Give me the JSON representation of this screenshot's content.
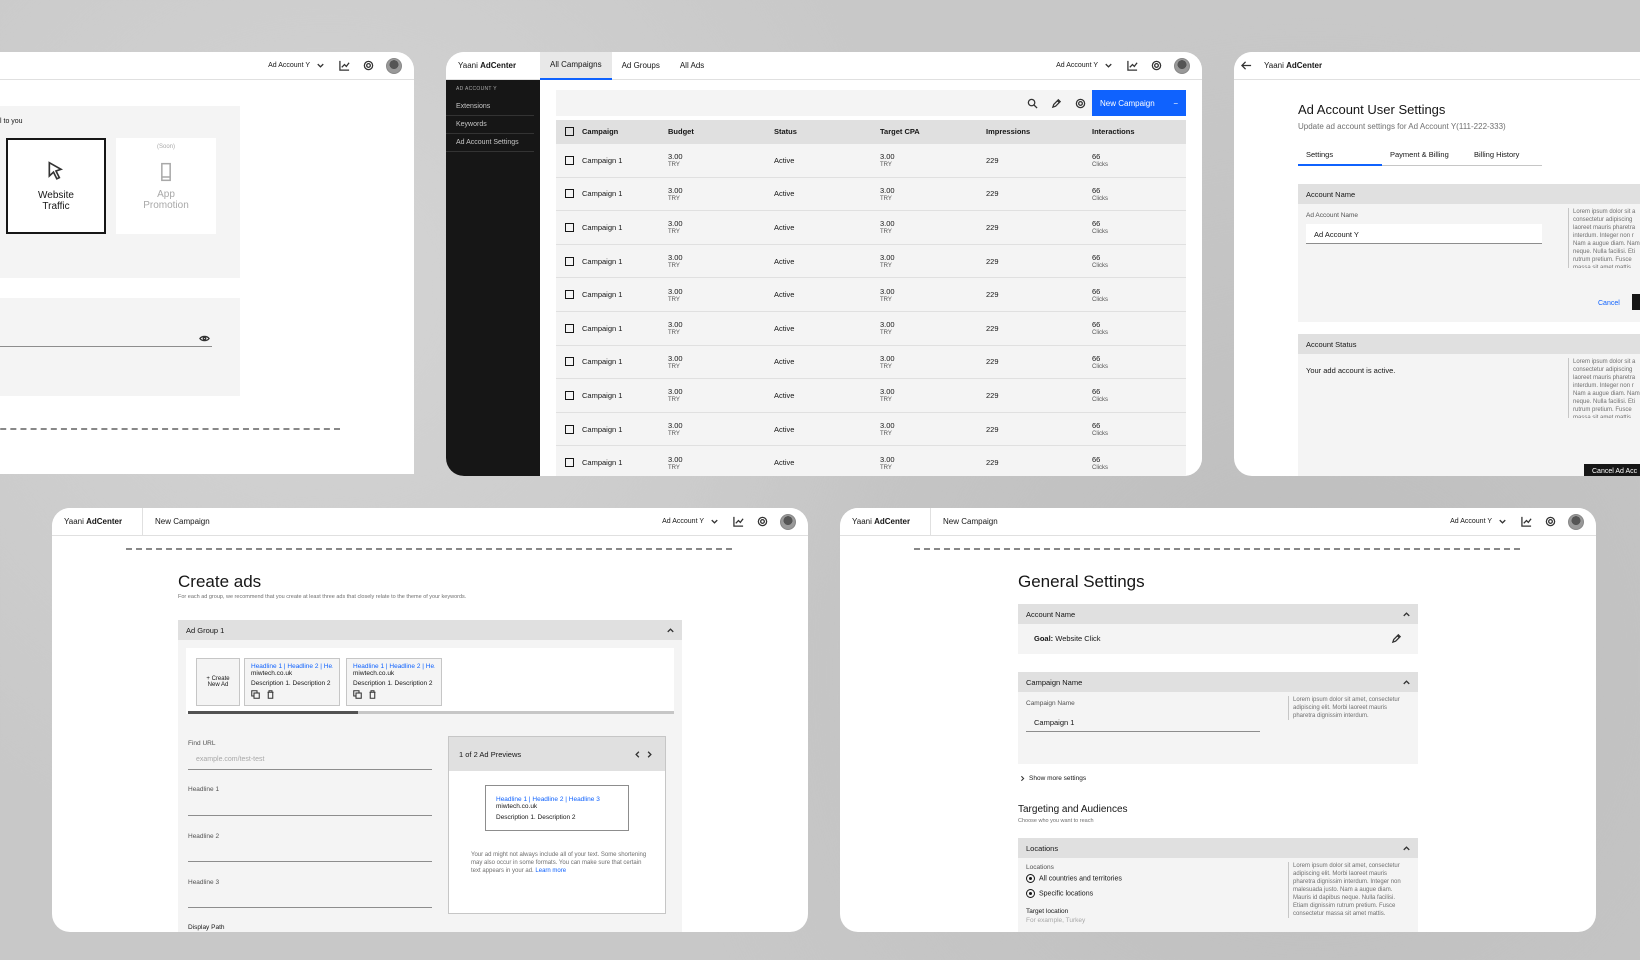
{
  "common": {
    "brand_prefix": "Yaani",
    "brand_name": "AdCenter",
    "account_selector": "Ad Account Y",
    "new_campaign_label": "New Campaign"
  },
  "panel_a": {
    "intro_text": "l to you",
    "tile_website": "Website Traffic",
    "tile_app_soon": "(Soon)",
    "tile_app": "App Promotion"
  },
  "panel_b": {
    "tabs": [
      "All Campaigns",
      "Ad Groups",
      "All Ads"
    ],
    "sidebar_header": "AD ACCOUNT Y",
    "sidebar_items": [
      "Extensions",
      "Keywords",
      "Ad Account Settings"
    ],
    "new_campaign_button": "New Campaign",
    "columns": [
      "Campaign",
      "Budget",
      "Status",
      "Target CPA",
      "Impressions",
      "Interactions"
    ],
    "rows": [
      {
        "campaign": "Campaign 1",
        "budget": "3.00",
        "budget_unit": "TRY",
        "status": "Active",
        "cpa": "3.00",
        "cpa_unit": "TRY",
        "impressions": "229",
        "interactions": "66",
        "interactions_unit": "Clicks"
      },
      {
        "campaign": "Campaign 1",
        "budget": "3.00",
        "budget_unit": "TRY",
        "status": "Active",
        "cpa": "3.00",
        "cpa_unit": "TRY",
        "impressions": "229",
        "interactions": "66",
        "interactions_unit": "Clicks"
      },
      {
        "campaign": "Campaign 1",
        "budget": "3.00",
        "budget_unit": "TRY",
        "status": "Active",
        "cpa": "3.00",
        "cpa_unit": "TRY",
        "impressions": "229",
        "interactions": "66",
        "interactions_unit": "Clicks"
      },
      {
        "campaign": "Campaign 1",
        "budget": "3.00",
        "budget_unit": "TRY",
        "status": "Active",
        "cpa": "3.00",
        "cpa_unit": "TRY",
        "impressions": "229",
        "interactions": "66",
        "interactions_unit": "Clicks"
      },
      {
        "campaign": "Campaign 1",
        "budget": "3.00",
        "budget_unit": "TRY",
        "status": "Active",
        "cpa": "3.00",
        "cpa_unit": "TRY",
        "impressions": "229",
        "interactions": "66",
        "interactions_unit": "Clicks"
      },
      {
        "campaign": "Campaign 1",
        "budget": "3.00",
        "budget_unit": "TRY",
        "status": "Active",
        "cpa": "3.00",
        "cpa_unit": "TRY",
        "impressions": "229",
        "interactions": "66",
        "interactions_unit": "Clicks"
      },
      {
        "campaign": "Campaign 1",
        "budget": "3.00",
        "budget_unit": "TRY",
        "status": "Active",
        "cpa": "3.00",
        "cpa_unit": "TRY",
        "impressions": "229",
        "interactions": "66",
        "interactions_unit": "Clicks"
      },
      {
        "campaign": "Campaign 1",
        "budget": "3.00",
        "budget_unit": "TRY",
        "status": "Active",
        "cpa": "3.00",
        "cpa_unit": "TRY",
        "impressions": "229",
        "interactions": "66",
        "interactions_unit": "Clicks"
      },
      {
        "campaign": "Campaign 1",
        "budget": "3.00",
        "budget_unit": "TRY",
        "status": "Active",
        "cpa": "3.00",
        "cpa_unit": "TRY",
        "impressions": "229",
        "interactions": "66",
        "interactions_unit": "Clicks"
      },
      {
        "campaign": "Campaign 1",
        "budget": "3.00",
        "budget_unit": "TRY",
        "status": "Active",
        "cpa": "3.00",
        "cpa_unit": "TRY",
        "impressions": "229",
        "interactions": "66",
        "interactions_unit": "Clicks"
      }
    ]
  },
  "panel_c": {
    "title": "Ad Account User Settings",
    "subtitle": "Update ad account settings for Ad Account Y(111-222-333)",
    "tabs": [
      "Settings",
      "Payment & Billing",
      "Billing History"
    ],
    "section_account_name": "Account Name",
    "field_label": "Ad Account Name",
    "field_value": "Ad Account Y",
    "cancel_link": "Cancel",
    "section_status": "Account Status",
    "status_text": "Your add account is active.",
    "cancel_account_button": "Cancel Ad Acc",
    "lorem": "Lorem ipsum dolor sit a consectetur adipiscing laoreet mauris pharetra interdum. Integer non r Nam a augue diam. Nam neque. Nulla facilisi. Eti rutrum pretium. Fusce massa sit amet mattis."
  },
  "panel_d": {
    "title": "Create ads",
    "subtitle": "For each ad group, we recommend that you create at least three ads that closely relate to the theme of your keywords.",
    "ad_group": "Ad Group 1",
    "create_new_ad": "+ Create New Ad",
    "ad_headline_short": "Headline 1 | Headline 2 | He...",
    "ad_url": "miwtech.co.uk",
    "ad_desc": "Description 1. Description 2",
    "final_url_label": "Find URL",
    "final_url_placeholder": "example.com/test-test",
    "headline1_label": "Headline 1",
    "headline2_label": "Headline 2",
    "headline3_label": "Headline 3",
    "display_path_label": "Display Path",
    "preview_header": "1 of 2 Ad Previews",
    "preview_headline": "Headline 1 | Headline 2 | Headline 3",
    "preview_url": "miwtech.co.uk",
    "preview_desc": "Description 1. Description 2",
    "preview_note": "Your ad might not always include all of your text. Some shortening may also occur in some formats. You can make sure that certain text appears in your ad.",
    "learn_more": "Learn more"
  },
  "panel_e": {
    "title": "General Settings",
    "section_account": "Account Name",
    "goal_label": "Goal:",
    "goal_value": "Website Click",
    "section_campaign": "Campaign Name",
    "campaign_field_label": "Campaign Name",
    "campaign_field_value": "Campaign 1",
    "lorem_short": "Lorem ipsum dolor sit amet, consectetur adipiscing elit. Morbi laoreet mauris pharetra dignissim interdum.",
    "show_more": "Show more settings",
    "targeting_title": "Targeting and Audiences",
    "targeting_sub": "Choose who you want to reach",
    "section_locations": "Locations",
    "locations_label": "Locations",
    "radio_all": "All countries and territories",
    "radio_specific": "Specific locations",
    "target_location_label": "Target location",
    "target_location_placeholder": "For example, Turkey",
    "lorem_long": "Lorem ipsum dolor sit amet, consectetur adipiscing elit. Morbi laoreet mauris pharetra dignissim interdum. Integer non malesuada justo. Nam a augue diam. Mauris id dapibus neque. Nulla facilisi. Etiam dignissim rutrum pretium. Fusce consectetur massa sit amet mattis."
  }
}
